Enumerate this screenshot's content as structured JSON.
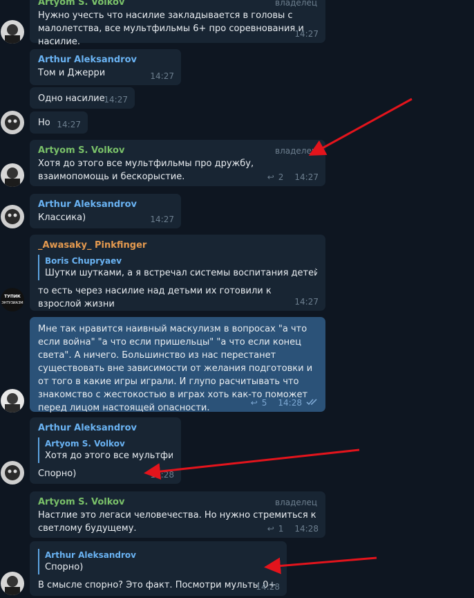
{
  "messages": [
    {
      "id": "m1",
      "name": "Artyom S. Volkov",
      "badge": "владелец",
      "text": "Нужно учесть что насилие закладывается в головы с малолетства, все мультфильмы 6+ про соревнования и насилие.",
      "time": "14:27"
    },
    {
      "id": "m2",
      "name": "Arthur Aleksandrov",
      "text": "Том и Джерри",
      "time": "14:27"
    },
    {
      "id": "m3",
      "text": "Одно насилие",
      "time": "14:27"
    },
    {
      "id": "m4",
      "text": "Но",
      "time": "14:27"
    },
    {
      "id": "m5",
      "name": "Artyom S. Volkov",
      "badge": "владелец",
      "text": "Хотя до этого все мультфильмы про дружбу, взаимопомощь и бескорыстие.",
      "replies": "2",
      "time": "14:27"
    },
    {
      "id": "m6",
      "name": "Arthur Aleksandrov",
      "text": "Классика)",
      "time": "14:27"
    },
    {
      "id": "m7",
      "name": "_Awasaky_ Pinkfinger",
      "reply_name": "Boris Chupryaev",
      "reply_text": "Шутки шутками, а я встречал системы воспитания детей с за...",
      "text": "то есть через насилие над детьми их готовили к взрослой жизни",
      "time": "14:27"
    },
    {
      "id": "m8",
      "text": "Мне так нравится наивный маскулизм в вопросах \"а что если война\" \"а что если пришельцы\" \"а что если конец света\".  А ничего. Большинство из нас перестанет существовать вне зависимости от желания подготовки и от того в какие игры играли. И глупо расчитывать что знакомство с жестокостью в играх хоть как-то поможет перед лицом настоящей опасности.",
      "replies": "5",
      "time": "14:28"
    },
    {
      "id": "m9",
      "name": "Arthur Aleksandrov",
      "reply_name": "Artyom S. Volkov",
      "reply_text": "Хотя до этого все мультфил...",
      "text": "Спорно)",
      "time": "14:28"
    },
    {
      "id": "m10",
      "name": "Artyom S. Volkov",
      "badge": "владелец",
      "text": "Настлие это легаси человечества. Но нужно стремиться к светлому будущему.",
      "replies": "1",
      "time": "14:28"
    },
    {
      "id": "m11",
      "reply_name": "Arthur Aleksandrov",
      "reply_text": "Спорно)",
      "text": "В смысле спорно? Это факт. Посмотри мульты 0+",
      "time": "14:28"
    }
  ],
  "avatar_labels": {
    "awasaky": "ТУПИК ЭНТУЗИАЗМ"
  },
  "colors": {
    "background": "#0e1621",
    "bubble": "#182533",
    "bubble_outgoing": "#2b5278",
    "name_volkov": "#7ac169",
    "name_aleksandrov": "#6ab3f3",
    "name_awasaky": "#e59a4f",
    "annotation_arrow": "#e3141c"
  },
  "icons": {
    "reply": "reply-arrow-icon",
    "read": "double-check-icon"
  }
}
